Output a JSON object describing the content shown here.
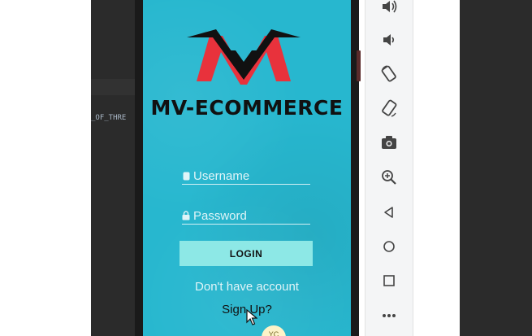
{
  "ide": {
    "code_snippet": "_OF_THRE"
  },
  "app": {
    "brand_name": "MV-ECOMMERCE",
    "username_placeholder": "Username",
    "password_placeholder": "Password",
    "login_label": "LOGIN",
    "no_account_text": "Don't have account",
    "signup_label": "Sign Up?",
    "badge_text": "YC"
  },
  "toolbar": {
    "tools": [
      "volume-up-icon",
      "volume-down-icon",
      "rotate-left-icon",
      "rotate-right-icon",
      "camera-icon",
      "zoom-icon",
      "back-icon",
      "home-icon",
      "overview-icon",
      "more-icon"
    ]
  },
  "colors": {
    "screen_bg": "#27b7cf",
    "logo_red": "#e8323c",
    "button_bg": "#8de8e6"
  }
}
